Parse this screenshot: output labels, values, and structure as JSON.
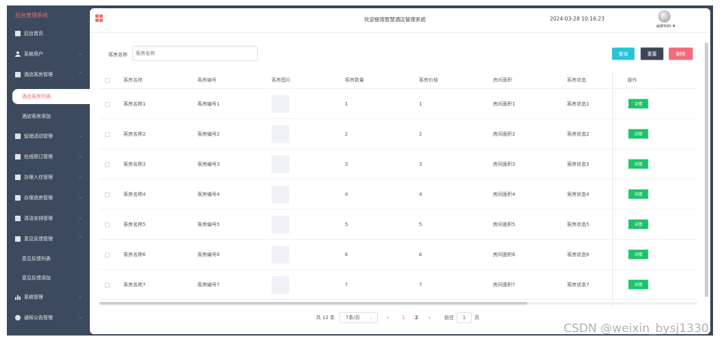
{
  "sidebar": {
    "brand": "后台管理系统",
    "items": [
      {
        "label": "后台首页",
        "icon": "monitor-icon"
      },
      {
        "label": "系统用户",
        "icon": "user-icon"
      },
      {
        "label": "酒店客房管理",
        "icon": "doc-icon"
      },
      {
        "label": "促销活动管理",
        "icon": "doc-icon"
      },
      {
        "label": "在线预订管理",
        "icon": "doc-icon"
      },
      {
        "label": "办理入住管理",
        "icon": "doc-icon"
      },
      {
        "label": "办理退房管理",
        "icon": "doc-icon"
      },
      {
        "label": "清洁安排管理",
        "icon": "doc-icon"
      },
      {
        "label": "意见反馈管理",
        "icon": "doc-icon"
      },
      {
        "label": "系统管理",
        "icon": "chart-icon"
      },
      {
        "label": "通知公告管理",
        "icon": "info-icon"
      }
    ],
    "subitems": {
      "room_list": "酒店客房列表",
      "room_add": "酒店客房添加",
      "feedback_list": "意见反馈列表",
      "feedback_add": "意见反馈添加"
    }
  },
  "topbar": {
    "welcome": "欢迎使用智慧酒店管理系统",
    "datetime": "2024-03-28 10:16:23",
    "user": "admin ▾"
  },
  "search": {
    "label": "客房名称",
    "placeholder": "客房名称",
    "query_label": "查询",
    "reset_label": "重置",
    "delete_label": "删除"
  },
  "table": {
    "headers": [
      "客房名称",
      "客房编号",
      "客房图片",
      "客房数量",
      "客房价格",
      "房间面积",
      "客房状态",
      "操作"
    ],
    "detail_label": "详情",
    "rows": [
      [
        "客房名称1",
        "客房编号1",
        "1",
        "1",
        "房间面积1",
        "客房状态1"
      ],
      [
        "客房名称2",
        "客房编号2",
        "2",
        "2",
        "房间面积2",
        "客房状态2"
      ],
      [
        "客房名称3",
        "客房编号3",
        "3",
        "3",
        "房间面积3",
        "客房状态3"
      ],
      [
        "客房名称4",
        "客房编号4",
        "4",
        "4",
        "房间面积4",
        "客房状态4"
      ],
      [
        "客房名称5",
        "客房编号5",
        "5",
        "5",
        "房间面积5",
        "客房状态5"
      ],
      [
        "客房名称6",
        "客房编号6",
        "6",
        "6",
        "房间面积6",
        "客房状态6"
      ],
      [
        "客房名称7",
        "客房编号7",
        "7",
        "7",
        "房间面积7",
        "客房状态7"
      ]
    ]
  },
  "pagination": {
    "total": "共 12 条",
    "page_size": "7条/页",
    "prev": "‹",
    "pages": [
      "1",
      "2"
    ],
    "next": "›",
    "goto": "前往",
    "goto_value": "1",
    "page_unit": "页"
  },
  "watermark": "CSDN @weixin_bysj1330",
  "colors": {
    "sidebar_bg": "#3d4a5d",
    "accent": "#f26b6b",
    "query": "#29c3d6",
    "reset": "#3d4658",
    "delete": "#f16b7d",
    "detail": "#1fc16b"
  }
}
